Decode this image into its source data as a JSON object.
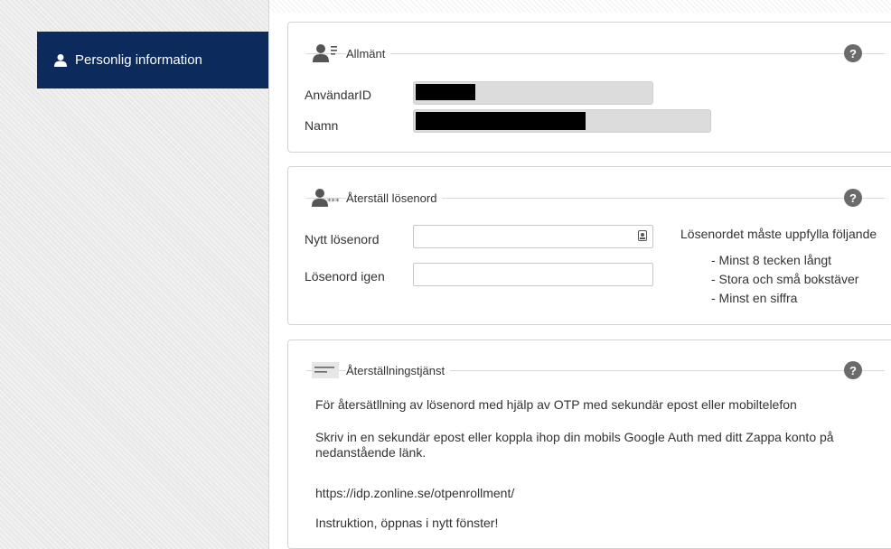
{
  "sidebar": {
    "items": [
      {
        "label": "Personlig information",
        "icon": "user-icon"
      }
    ]
  },
  "general": {
    "title": "Allmänt",
    "help": "?",
    "userid_label": "AnvändarID",
    "name_label": "Namn"
  },
  "reset": {
    "title": "Återställ lösenord",
    "help": "?",
    "new_password_label": "Nytt lösenord",
    "repeat_password_label": "Lösenord igen",
    "requirements_title": "Lösenordet måste uppfylla följande",
    "requirements": [
      "- Minst 8 tecken långt",
      "- Stora och små bokstäver",
      "- Minst en siffra"
    ]
  },
  "recovery": {
    "title": "Återställningstjänst",
    "help": "?",
    "line1": "För återsätllning av lösenord med hjälp av OTP med sekundär epost eller mobiltelefon",
    "line2": "Skriv in en sekundär epost eller koppla ihop din mobils Google Auth med ditt Zappa konto på nedanstående länk.",
    "link": "https://idp.zonline.se/otpenrollment/",
    "instructions": "Instruktion, öppnas i nytt fönster!"
  },
  "colors": {
    "nav_active": "#0c2a5b",
    "help_bg": "#6b6b6b",
    "field_bg": "#dcdcdc"
  }
}
